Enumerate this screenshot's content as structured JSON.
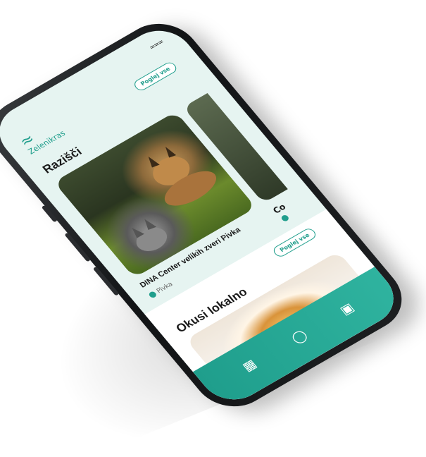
{
  "status": {
    "icon": "signal-icon"
  },
  "brand": {
    "name": "Zelenikras"
  },
  "explore": {
    "title": "Razišči",
    "see_all_label": "Poglej vse",
    "featured": {
      "title": "DINA Center velikih zveri Pivka",
      "location": "Pivka"
    },
    "next_card_label": "Co"
  },
  "local_taste": {
    "title": "Okusi lokalno",
    "see_all_label": "Poglej vse"
  },
  "tabbar": {
    "items": [
      {
        "icon": "grid-icon"
      },
      {
        "icon": "map-pin-icon"
      },
      {
        "icon": "map-icon"
      }
    ]
  },
  "colors": {
    "accent": "#1f9e8c",
    "screen_bg": "#e6f4f1"
  }
}
